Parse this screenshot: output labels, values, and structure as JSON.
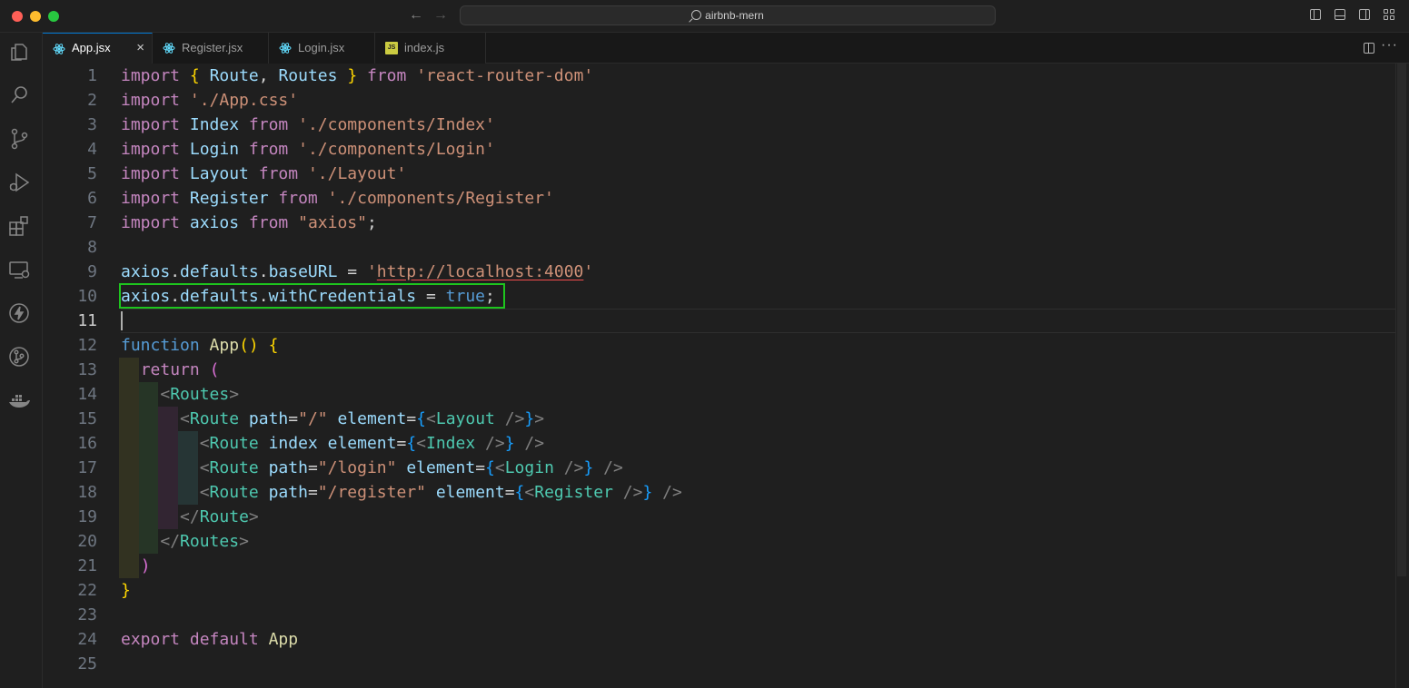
{
  "window": {
    "search_text": "airbnb-mern"
  },
  "tabs": [
    {
      "label": "App.jsx",
      "active": true,
      "icon": "react-icon"
    },
    {
      "label": "Register.jsx",
      "active": false,
      "icon": "react-icon"
    },
    {
      "label": "Login.jsx",
      "active": false,
      "icon": "react-icon"
    },
    {
      "label": "index.js",
      "active": false,
      "icon": "js-icon",
      "badge": "JS"
    }
  ],
  "activity_bar": [
    "explorer-icon",
    "search-icon",
    "source-control-icon",
    "run-debug-icon",
    "extensions-icon",
    "remote-explorer-icon",
    "thunder-client-icon",
    "git-graph-icon",
    "docker-icon"
  ],
  "editor": {
    "current_line": 11,
    "highlighted_line": 10,
    "lines": [
      [
        [
          "kw",
          "import"
        ],
        [
          "pl",
          " "
        ],
        [
          "br1",
          "{"
        ],
        [
          "pl",
          " "
        ],
        [
          "id",
          "Route"
        ],
        [
          "pl",
          ", "
        ],
        [
          "id",
          "Routes"
        ],
        [
          "pl",
          " "
        ],
        [
          "br1",
          "}"
        ],
        [
          "pl",
          " "
        ],
        [
          "kw",
          "from"
        ],
        [
          "pl",
          " "
        ],
        [
          "str",
          "'react-router-dom'"
        ]
      ],
      [
        [
          "kw",
          "import"
        ],
        [
          "pl",
          " "
        ],
        [
          "str",
          "'./App.css'"
        ]
      ],
      [
        [
          "kw",
          "import"
        ],
        [
          "pl",
          " "
        ],
        [
          "id",
          "Index"
        ],
        [
          "pl",
          " "
        ],
        [
          "kw",
          "from"
        ],
        [
          "pl",
          " "
        ],
        [
          "str",
          "'./components/Index'"
        ]
      ],
      [
        [
          "kw",
          "import"
        ],
        [
          "pl",
          " "
        ],
        [
          "id",
          "Login"
        ],
        [
          "pl",
          " "
        ],
        [
          "kw",
          "from"
        ],
        [
          "pl",
          " "
        ],
        [
          "str",
          "'./components/Login'"
        ]
      ],
      [
        [
          "kw",
          "import"
        ],
        [
          "pl",
          " "
        ],
        [
          "id",
          "Layout"
        ],
        [
          "pl",
          " "
        ],
        [
          "kw",
          "from"
        ],
        [
          "pl",
          " "
        ],
        [
          "str",
          "'./Layout'"
        ]
      ],
      [
        [
          "kw",
          "import"
        ],
        [
          "pl",
          " "
        ],
        [
          "id",
          "Register"
        ],
        [
          "pl",
          " "
        ],
        [
          "kw",
          "from"
        ],
        [
          "pl",
          " "
        ],
        [
          "str",
          "'./components/Register'"
        ]
      ],
      [
        [
          "kw",
          "import"
        ],
        [
          "pl",
          " "
        ],
        [
          "id",
          "axios"
        ],
        [
          "pl",
          " "
        ],
        [
          "kw",
          "from"
        ],
        [
          "pl",
          " "
        ],
        [
          "str",
          "\"axios\""
        ],
        [
          "pl",
          ";"
        ]
      ],
      [],
      [
        [
          "id",
          "axios"
        ],
        [
          "pl",
          "."
        ],
        [
          "id",
          "defaults"
        ],
        [
          "pl",
          "."
        ],
        [
          "id",
          "baseURL"
        ],
        [
          "pl",
          " = "
        ],
        [
          "str",
          "'"
        ],
        [
          "str uline",
          "http://localhost:4000"
        ],
        [
          "str",
          "'"
        ]
      ],
      [
        [
          "id",
          "axios"
        ],
        [
          "pl",
          "."
        ],
        [
          "id",
          "defaults"
        ],
        [
          "pl",
          "."
        ],
        [
          "id",
          "withCredentials"
        ],
        [
          "pl",
          " = "
        ],
        [
          "kw2",
          "true"
        ],
        [
          "pl",
          ";"
        ]
      ],
      [],
      [
        [
          "kw2",
          "function"
        ],
        [
          "pl",
          " "
        ],
        [
          "fn",
          "App"
        ],
        [
          "br1",
          "()"
        ],
        [
          "pl",
          " "
        ],
        [
          "br1",
          "{"
        ]
      ],
      [
        [
          "pl",
          "  "
        ],
        [
          "kw",
          "return"
        ],
        [
          "pl",
          " "
        ],
        [
          "br2",
          "("
        ]
      ],
      [
        [
          "pl",
          "    "
        ],
        [
          "tag",
          "<"
        ],
        [
          "cls",
          "Routes"
        ],
        [
          "tag",
          ">"
        ]
      ],
      [
        [
          "pl",
          "      "
        ],
        [
          "tag",
          "<"
        ],
        [
          "cls",
          "Route"
        ],
        [
          "pl",
          " "
        ],
        [
          "attr",
          "path"
        ],
        [
          "pl",
          "="
        ],
        [
          "str",
          "\"/\""
        ],
        [
          "pl",
          " "
        ],
        [
          "attr",
          "element"
        ],
        [
          "pl",
          "="
        ],
        [
          "br3",
          "{"
        ],
        [
          "tag",
          "<"
        ],
        [
          "cls",
          "Layout"
        ],
        [
          "pl",
          " "
        ],
        [
          "tag",
          "/>"
        ],
        [
          "br3",
          "}"
        ],
        [
          "tag",
          ">"
        ]
      ],
      [
        [
          "pl",
          "        "
        ],
        [
          "tag",
          "<"
        ],
        [
          "cls",
          "Route"
        ],
        [
          "pl",
          " "
        ],
        [
          "attr",
          "index"
        ],
        [
          "pl",
          " "
        ],
        [
          "attr",
          "element"
        ],
        [
          "pl",
          "="
        ],
        [
          "br3",
          "{"
        ],
        [
          "tag",
          "<"
        ],
        [
          "cls",
          "Index"
        ],
        [
          "pl",
          " "
        ],
        [
          "tag",
          "/>"
        ],
        [
          "br3",
          "}"
        ],
        [
          "pl",
          " "
        ],
        [
          "tag",
          "/>"
        ]
      ],
      [
        [
          "pl",
          "        "
        ],
        [
          "tag",
          "<"
        ],
        [
          "cls",
          "Route"
        ],
        [
          "pl",
          " "
        ],
        [
          "attr",
          "path"
        ],
        [
          "pl",
          "="
        ],
        [
          "str",
          "\"/login\""
        ],
        [
          "pl",
          " "
        ],
        [
          "attr",
          "element"
        ],
        [
          "pl",
          "="
        ],
        [
          "br3",
          "{"
        ],
        [
          "tag",
          "<"
        ],
        [
          "cls",
          "Login"
        ],
        [
          "pl",
          " "
        ],
        [
          "tag",
          "/>"
        ],
        [
          "br3",
          "}"
        ],
        [
          "pl",
          " "
        ],
        [
          "tag",
          "/>"
        ]
      ],
      [
        [
          "pl",
          "        "
        ],
        [
          "tag",
          "<"
        ],
        [
          "cls",
          "Route"
        ],
        [
          "pl",
          " "
        ],
        [
          "attr",
          "path"
        ],
        [
          "pl",
          "="
        ],
        [
          "str",
          "\"/register\""
        ],
        [
          "pl",
          " "
        ],
        [
          "attr",
          "element"
        ],
        [
          "pl",
          "="
        ],
        [
          "br3",
          "{"
        ],
        [
          "tag",
          "<"
        ],
        [
          "cls",
          "Register"
        ],
        [
          "pl",
          " "
        ],
        [
          "tag",
          "/>"
        ],
        [
          "br3",
          "}"
        ],
        [
          "pl",
          " "
        ],
        [
          "tag",
          "/>"
        ]
      ],
      [
        [
          "pl",
          "      "
        ],
        [
          "tag",
          "</"
        ],
        [
          "cls",
          "Route"
        ],
        [
          "tag",
          ">"
        ]
      ],
      [
        [
          "pl",
          "    "
        ],
        [
          "tag",
          "</"
        ],
        [
          "cls",
          "Routes"
        ],
        [
          "tag",
          ">"
        ]
      ],
      [
        [
          "pl",
          "  "
        ],
        [
          "br2",
          ")"
        ]
      ],
      [
        [
          "br1",
          "}"
        ]
      ],
      [],
      [
        [
          "kw",
          "export"
        ],
        [
          "pl",
          " "
        ],
        [
          "kw",
          "default"
        ],
        [
          "pl",
          " "
        ],
        [
          "fn",
          "App"
        ]
      ],
      []
    ]
  }
}
